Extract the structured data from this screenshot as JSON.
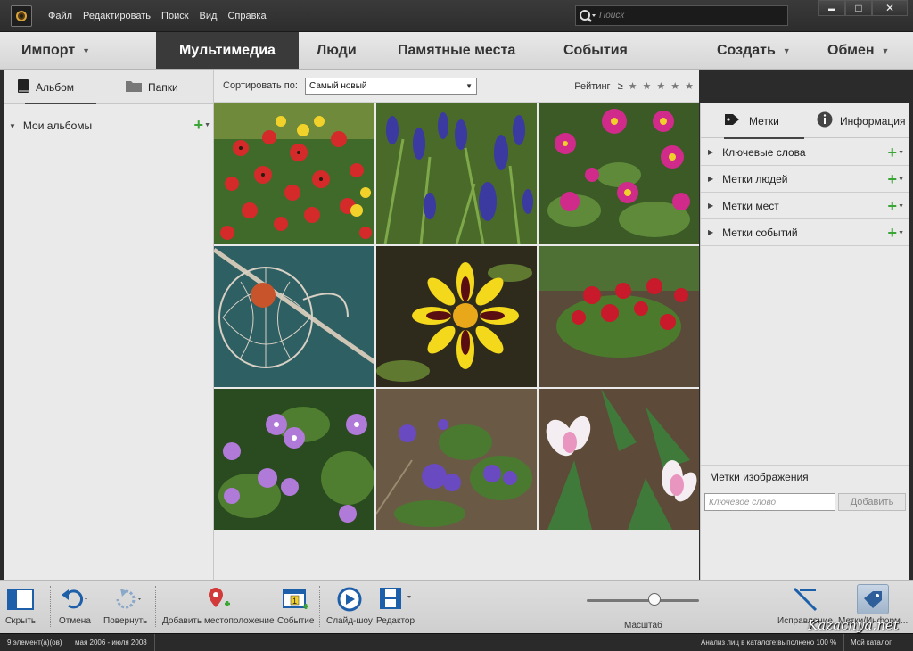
{
  "menu": [
    "Файл",
    "Редактировать",
    "Поиск",
    "Вид",
    "Справка"
  ],
  "search": {
    "placeholder": "Поиск"
  },
  "window_controls": {
    "minimize": "▬",
    "maximize": "□",
    "close": "✕"
  },
  "nav": {
    "import": "Импорт",
    "media": "Мультимедиа",
    "people": "Люди",
    "places": "Памятные места",
    "events": "События",
    "create": "Создать",
    "share": "Обмен"
  },
  "left_panel": {
    "tab_album": "Альбом",
    "tab_folders": "Папки",
    "my_albums": "Мои альбомы"
  },
  "sort": {
    "label": "Сортировать по:",
    "value": "Самый новый",
    "rating_label": "Рейтинг",
    "rating_op": "≥",
    "stars": 5
  },
  "photos": [
    {
      "name": "red-yellow-flowers"
    },
    {
      "name": "blue-muscari"
    },
    {
      "name": "magenta-primula"
    },
    {
      "name": "physalis-lantern"
    },
    {
      "name": "marigold"
    },
    {
      "name": "red-flowers-soil"
    },
    {
      "name": "purple-violets"
    },
    {
      "name": "small-purple-flowers"
    },
    {
      "name": "white-pink-tulips"
    }
  ],
  "right_panel": {
    "tab_tags": "Метки",
    "tab_info": "Информация",
    "rows": [
      "Ключевые слова",
      "Метки людей",
      "Метки мест",
      "Метки событий"
    ],
    "image_tags_title": "Метки изображения",
    "keyword_placeholder": "Ключевое слово",
    "add_button": "Добавить"
  },
  "toolbar": {
    "hide": "Скрыть",
    "undo": "Отмена",
    "rotate": "Повернуть",
    "add_location": "Добавить местоположение",
    "event": "Событие",
    "slideshow": "Слайд-шоу",
    "editor": "Редактор",
    "zoom": "Масштаб",
    "fix": "Исправление",
    "tags_info": "Метки/Информ..."
  },
  "status": {
    "count": "9 элемент(а)(ов)",
    "date_range": "мая 2006 - июля 2008",
    "face_analysis": "Анализ лиц в каталоге:выполнено 100 %",
    "catalog": "Мой каталог"
  },
  "watermark": "Kazachya.net",
  "colors": {
    "accent_green": "#3aa535",
    "nav_active_bg": "#3a3a3a"
  }
}
